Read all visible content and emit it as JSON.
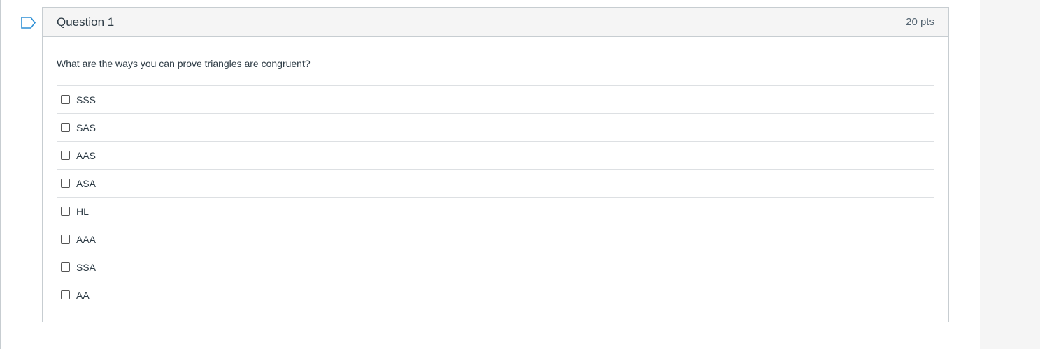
{
  "question": {
    "title": "Question 1",
    "points": "20 pts",
    "text": "What are the ways you can prove triangles are congruent?",
    "answers": [
      {
        "label": "SSS",
        "checked": false
      },
      {
        "label": "SAS",
        "checked": false
      },
      {
        "label": "AAS",
        "checked": false
      },
      {
        "label": "ASA",
        "checked": false
      },
      {
        "label": "HL",
        "checked": false
      },
      {
        "label": "AAA",
        "checked": false
      },
      {
        "label": "SSA",
        "checked": false
      },
      {
        "label": "AA",
        "checked": false
      }
    ]
  },
  "icons": {
    "flag": "bookmark-flag-icon"
  },
  "colors": {
    "flag": "#2d8fd5",
    "header_bg": "#f5f5f5",
    "border": "#c7cdd1"
  }
}
